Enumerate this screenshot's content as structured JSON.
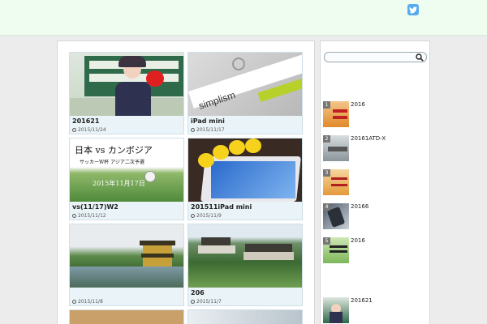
{
  "header": {
    "twitter_icon": "twitter-icon"
  },
  "cards": [
    {
      "title": "201621",
      "date": "2015/11/24"
    },
    {
      "title": "iPad mini",
      "date": "2015/11/17",
      "overlay": "simplism"
    },
    {
      "title": "vs(11/17)W2",
      "date": "2015/11/12",
      "overlay_line1": "日本 vs カンボジア",
      "overlay_line2": "サッカーW杯 アジア二次予選",
      "overlay_line3": "2015年11月17日"
    },
    {
      "title": "201511iPad mini",
      "date": "2015/11/9"
    },
    {
      "title": "",
      "date": "2015/11/8"
    },
    {
      "title": "206",
      "date": "2015/11/7"
    }
  ],
  "sidebar": {
    "search_placeholder": "",
    "popular": [
      {
        "rank": "1",
        "title": "2016"
      },
      {
        "rank": "2",
        "title": "20161ATD-X"
      },
      {
        "rank": "3",
        "title": ""
      },
      {
        "rank": "4",
        "title": "20166"
      },
      {
        "rank": "5",
        "title": "2016"
      },
      {
        "rank": "",
        "title": "201621"
      }
    ]
  }
}
